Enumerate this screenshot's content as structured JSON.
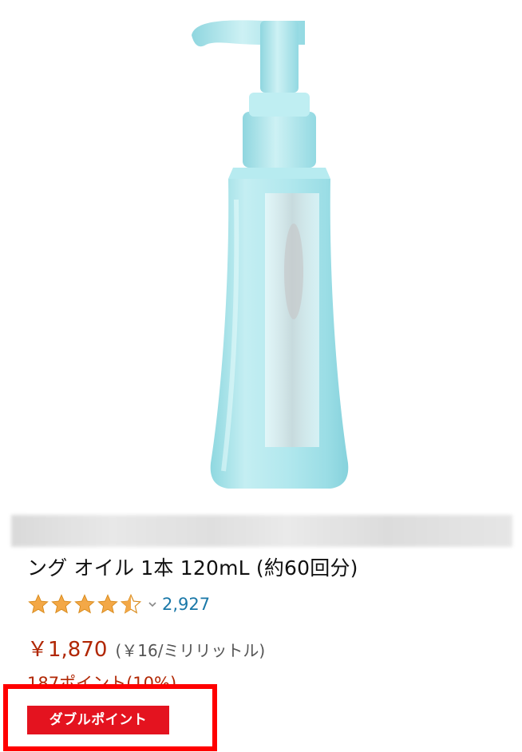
{
  "product": {
    "image_icon": "pump-bottle-image",
    "title_visible": "ング オイル 1本 120mL (約60回分)",
    "rating": {
      "stars": 4.5,
      "max_stars": 5,
      "count_text": "2,927"
    },
    "price": "￥1,870",
    "unit_price": "(￥16/ミリリットル)",
    "points": "187ポイント(10%)",
    "badge": "ダブルポイント"
  },
  "colors": {
    "price": "#b12704",
    "star": "#f3a847",
    "link": "#1a78a8",
    "badge_bg": "#e4131f",
    "highlight_border": "#ff0000",
    "bottle": "#a9e4ea"
  }
}
